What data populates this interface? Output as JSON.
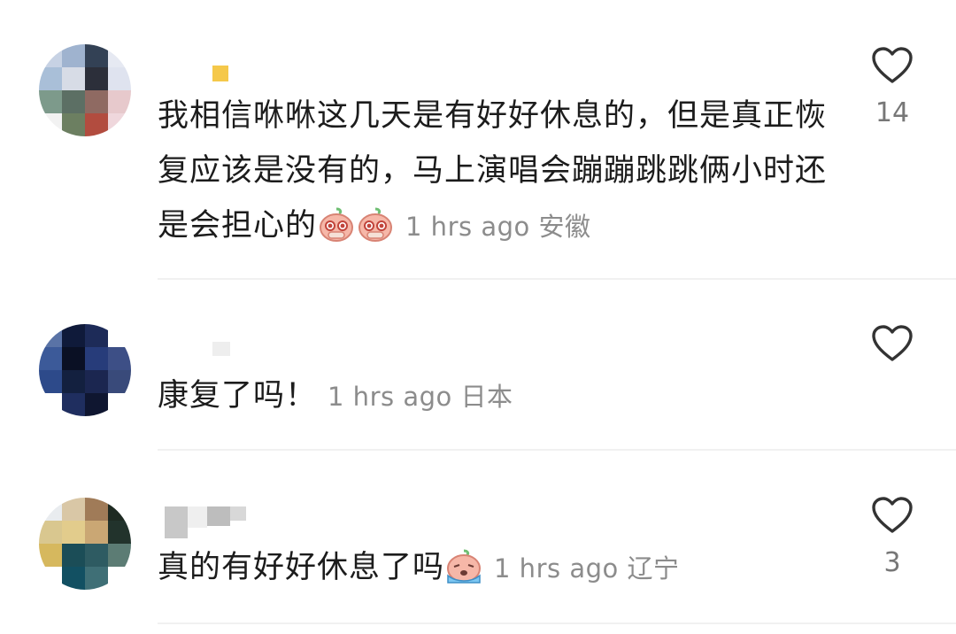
{
  "comments": [
    {
      "text": "我相信咻咻这几天是有好好休息的，但是真正恢复应该是没有的，马上演唱会蹦蹦跳跳俩小时还是会担心的",
      "emoji_count": 2,
      "time": "1 hrs ago",
      "location": "安徽",
      "likes": "14",
      "name_accent": "#f5c84a"
    },
    {
      "text": "康复了吗！",
      "time": "1 hrs ago",
      "location": "日本",
      "likes": ""
    },
    {
      "text": "真的有好好休息了吗",
      "emoji_count": 1,
      "time": "1 hrs ago",
      "location": "辽宁",
      "likes": "3"
    }
  ],
  "icons": {
    "like": "heart-outline-icon",
    "emoji_blush": "blushing-face-emoji",
    "emoji_cry": "crying-face-emoji"
  },
  "colors": {
    "text": "#1c1c1c",
    "meta": "#8c8c8c",
    "icon": "#333333",
    "divider": "#f1f1f1"
  }
}
